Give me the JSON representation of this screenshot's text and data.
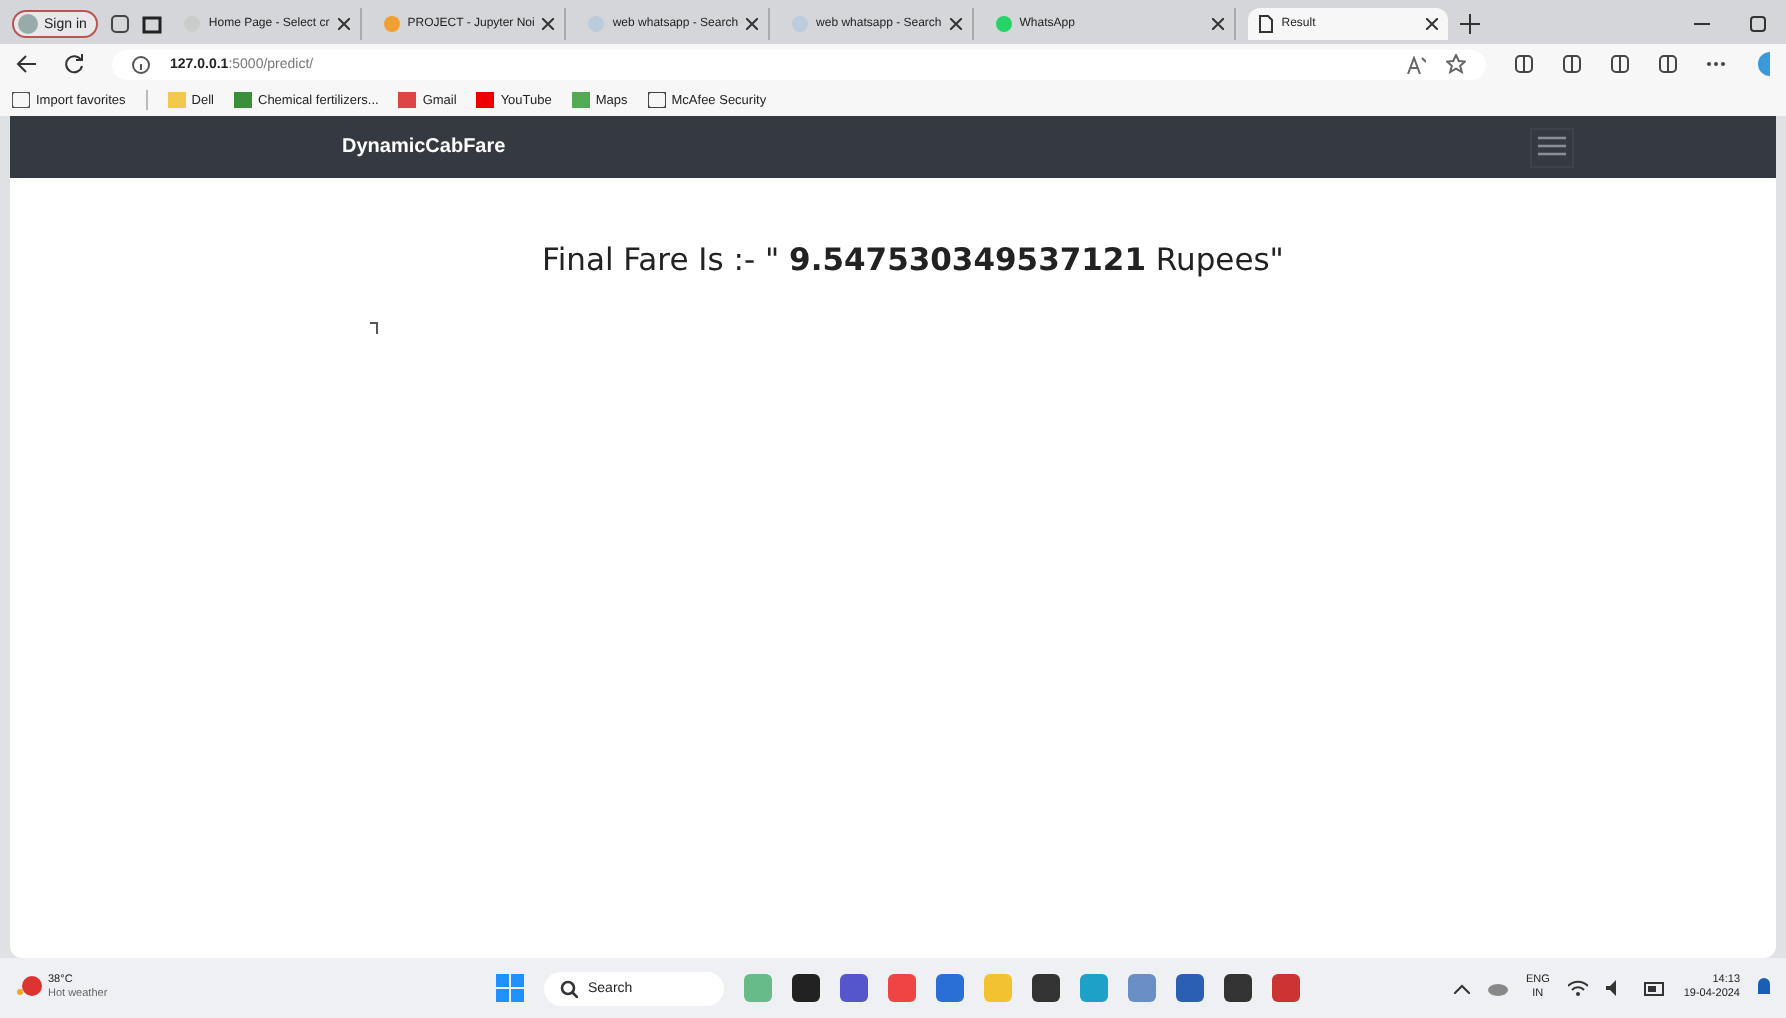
{
  "browser": {
    "profile": "Sign in",
    "tabs": [
      {
        "title": "Home Page - Select cr",
        "selected": false
      },
      {
        "title": "PROJECT - Jupyter Noi",
        "selected": false
      },
      {
        "title": "web whatsapp - Search",
        "selected": false
      },
      {
        "title": "web whatsapp - Search",
        "selected": false
      },
      {
        "title": "WhatsApp",
        "selected": false
      },
      {
        "title": "Result",
        "selected": true
      }
    ],
    "url_host": "127.0.0.1",
    "url_path": ":5000/predict/",
    "bookmarks": [
      "Import favorites",
      "Dell",
      "Chemical fertilizers...",
      "Gmail",
      "YouTube",
      "Maps",
      "McAfee Security"
    ]
  },
  "page": {
    "brand": "DynamicCabFare",
    "result_prefix": "Final Fare Is :- \" ",
    "result_value": "9.547530349537121",
    "result_suffix": " Rupees\""
  },
  "taskbar": {
    "temperature": "38°C",
    "weather": "Hot weather",
    "search_placeholder": "Search",
    "language": "ENG",
    "region": "IN",
    "time": "14:13",
    "date": "19-04-2024"
  }
}
